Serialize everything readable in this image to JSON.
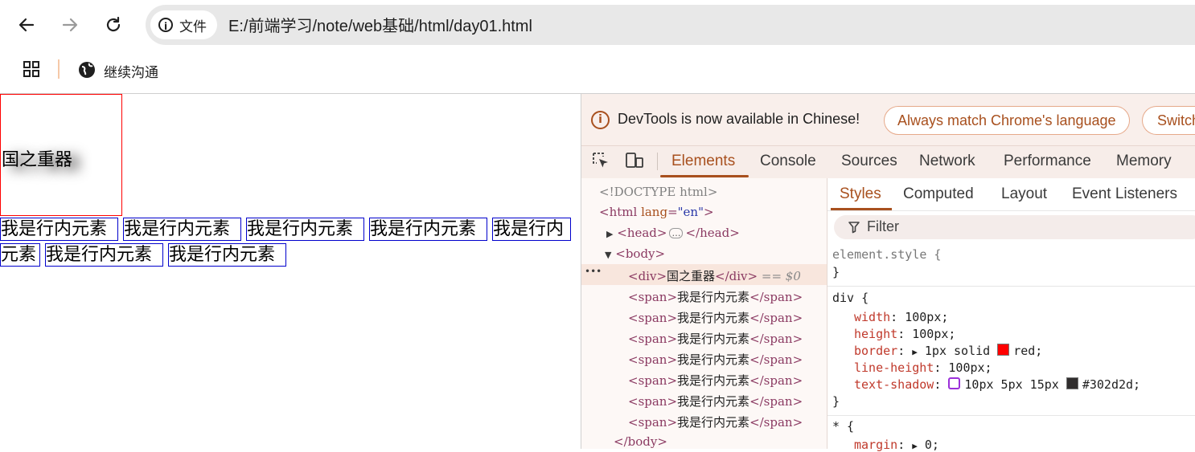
{
  "browser": {
    "chip_label": "文件",
    "url": "E:/前端学习/note/web基础/html/day01.html",
    "bookmark_label": "继续沟通"
  },
  "page": {
    "div_text": "国之重器",
    "spans": [
      "我是行内元素",
      "我是行内元素",
      "我是行内元素",
      "我是行内元素",
      "我是行内",
      "元素",
      "我是行内元素",
      "我是行内元素"
    ]
  },
  "devtools": {
    "banner_text": "DevTools is now available in Chinese!",
    "banner_btn1": "Always match Chrome's language",
    "banner_btn2": "Switch",
    "tabs": [
      "Elements",
      "Console",
      "Sources",
      "Network",
      "Performance",
      "Memory"
    ],
    "dom": {
      "doctype": "<!DOCTYPE html>",
      "html_open_tag": "<html",
      "html_attr_name": "lang",
      "html_attr_value": "\"en\"",
      "html_close_bracket": ">",
      "head_open": "<head>",
      "head_ellipsis": "…",
      "head_close": "</head>",
      "body_open": "<body>",
      "div_open": "<div>",
      "div_text": "国之重器",
      "div_close": "</div>",
      "div_marker": "== $0",
      "span_open": "<span>",
      "span_text": "我是行内元素",
      "span_close": "</span>",
      "body_close": "</body>",
      "row_dots": "•••"
    },
    "subtabs": [
      "Styles",
      "Computed",
      "Layout",
      "Event Listeners"
    ],
    "filter_placeholder": "Filter",
    "styles": {
      "element_style_selector": "element.style {",
      "close_brace": "}",
      "div_selector": "div {",
      "width_prop": "width",
      "width_val": "100px;",
      "height_prop": "height",
      "height_val": "100px;",
      "border_prop": "border",
      "border_val_a": "1px solid",
      "border_val_b": "red;",
      "line_height_prop": "line-height",
      "line_height_val": "100px;",
      "text_shadow_prop": "text-shadow",
      "text_shadow_val_a": "10px 5px 15px",
      "text_shadow_val_b": "#302d2d;",
      "star_selector": "* {",
      "margin_prop": "margin",
      "margin_val": "0;"
    },
    "colors": {
      "accent": "#a8501e",
      "red_swatch": "#ff0000",
      "shadow_swatch": "#302d2d"
    }
  }
}
